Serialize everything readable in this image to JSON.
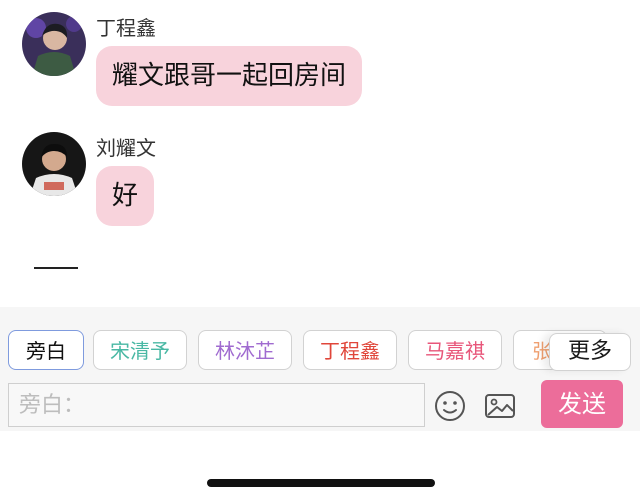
{
  "messages": [
    {
      "sender": "丁程鑫",
      "text": "耀文跟哥一起回房间"
    },
    {
      "sender": "刘耀文",
      "text": "好"
    }
  ],
  "role_chips": [
    {
      "label": "旁白",
      "color": "#111111"
    },
    {
      "label": "宋清予",
      "color": "#49b8a4"
    },
    {
      "label": "林沐芷",
      "color": "#a06bd0"
    },
    {
      "label": "丁程鑫",
      "color": "#e0463a"
    },
    {
      "label": "马嘉祺",
      "color": "#e8567a"
    },
    {
      "label": "张",
      "color": "#f0a070"
    }
  ],
  "more_label": "更多",
  "input": {
    "placeholder": "旁白："
  },
  "send_label": "发送",
  "colors": {
    "bubble": "#f8d3dc",
    "send": "#ec6d9a",
    "selected_border": "#7f9bde"
  }
}
